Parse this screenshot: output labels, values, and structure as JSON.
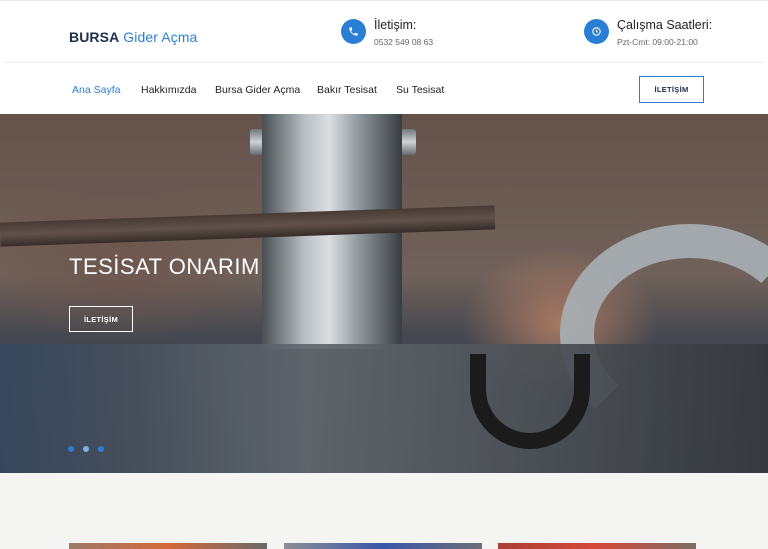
{
  "header": {
    "logo_bold": "BURSA",
    "logo_regular": "Gider Açma",
    "contacts": [
      {
        "icon": "phone-icon",
        "title": "İletişim:",
        "sub": "0532 549 08 63"
      },
      {
        "icon": "clock-icon",
        "title": "Çalışma Saatleri:",
        "sub": "Pzt-Cmt: 09:00-21:00"
      }
    ],
    "accent": "#2a7fd4"
  },
  "nav": {
    "items": [
      {
        "label": "Ana Sayfa",
        "active": true
      },
      {
        "label": "Hakkımızda",
        "active": false
      },
      {
        "label": "Bursa Gider Açma",
        "active": false
      },
      {
        "label": "Bakır Tesisat",
        "active": false
      },
      {
        "label": "Su Tesisat",
        "active": false
      }
    ],
    "cta_label": "İLETİŞİM"
  },
  "hero": {
    "title": "TESİSAT ONARIM",
    "button_label": "İLETİŞİM",
    "slides_count": 3,
    "active_slide": 2
  }
}
